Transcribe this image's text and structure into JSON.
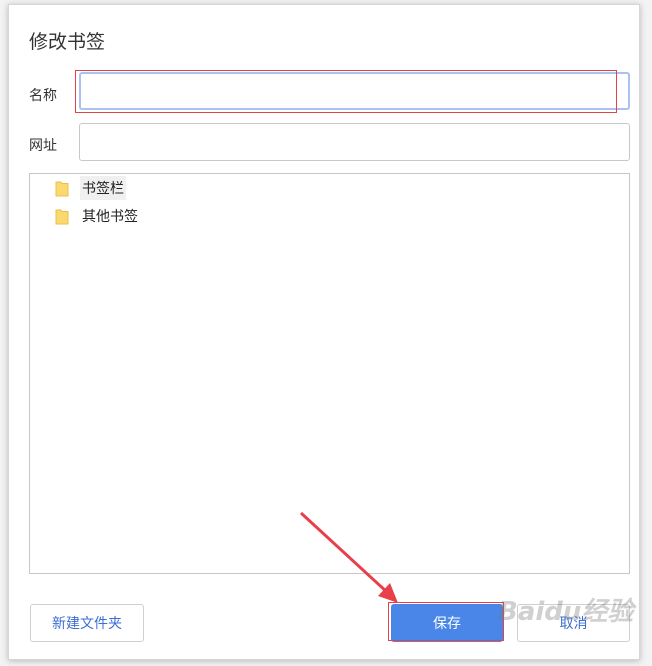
{
  "dialog": {
    "title": "修改书签",
    "name_label": "名称",
    "name_value": "",
    "url_label": "网址",
    "url_value": "",
    "folders": [
      {
        "label": "书签栏",
        "selected": true
      },
      {
        "label": "其他书签",
        "selected": false
      }
    ],
    "new_folder_label": "新建文件夹",
    "save_label": "保存",
    "cancel_label": "取消"
  },
  "colors": {
    "primary": "#4a86e8",
    "annotation_red": "#e8404a",
    "folder": "#fbd96e"
  },
  "watermark": "Baidu经验"
}
